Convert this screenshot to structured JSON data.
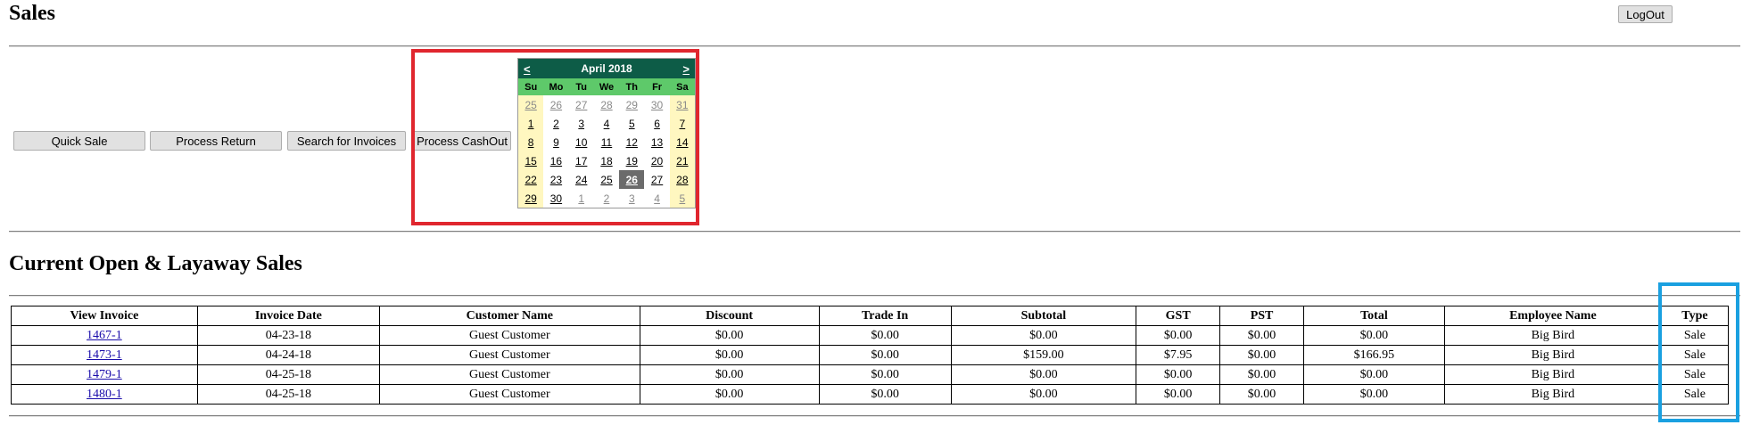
{
  "header": {
    "title": "Sales",
    "logout_label": "LogOut"
  },
  "actions": {
    "quick_sale": "Quick Sale",
    "process_return": "Process Return",
    "search_invoices": "Search for Invoices",
    "process_cashout": "Process CashOut"
  },
  "calendar": {
    "prev": "<",
    "next": ">",
    "month_label": "April 2018",
    "weekdays": [
      "Su",
      "Mo",
      "Tu",
      "We",
      "Th",
      "Fr",
      "Sa"
    ],
    "days": [
      {
        "d": "25",
        "other": true
      },
      {
        "d": "26",
        "other": true
      },
      {
        "d": "27",
        "other": true
      },
      {
        "d": "28",
        "other": true
      },
      {
        "d": "29",
        "other": true
      },
      {
        "d": "30",
        "other": true
      },
      {
        "d": "31",
        "other": true
      },
      {
        "d": "1"
      },
      {
        "d": "2"
      },
      {
        "d": "3"
      },
      {
        "d": "4"
      },
      {
        "d": "5"
      },
      {
        "d": "6"
      },
      {
        "d": "7"
      },
      {
        "d": "8"
      },
      {
        "d": "9"
      },
      {
        "d": "10"
      },
      {
        "d": "11"
      },
      {
        "d": "12"
      },
      {
        "d": "13"
      },
      {
        "d": "14"
      },
      {
        "d": "15"
      },
      {
        "d": "16"
      },
      {
        "d": "17"
      },
      {
        "d": "18"
      },
      {
        "d": "19"
      },
      {
        "d": "20"
      },
      {
        "d": "21"
      },
      {
        "d": "22"
      },
      {
        "d": "23"
      },
      {
        "d": "24"
      },
      {
        "d": "25"
      },
      {
        "d": "26",
        "selected": true
      },
      {
        "d": "27"
      },
      {
        "d": "28"
      },
      {
        "d": "29"
      },
      {
        "d": "30"
      },
      {
        "d": "1",
        "other": true
      },
      {
        "d": "2",
        "other": true
      },
      {
        "d": "3",
        "other": true
      },
      {
        "d": "4",
        "other": true
      },
      {
        "d": "5",
        "other": true
      }
    ]
  },
  "section": {
    "title": "Current Open & Layaway Sales"
  },
  "table": {
    "headers": [
      "View Invoice",
      "Invoice Date",
      "Customer Name",
      "Discount",
      "Trade In",
      "Subtotal",
      "GST",
      "PST",
      "Total",
      "Employee Name",
      "Type"
    ],
    "rows": [
      [
        "1467-1",
        "04-23-18",
        "Guest Customer",
        "$0.00",
        "$0.00",
        "$0.00",
        "$0.00",
        "$0.00",
        "$0.00",
        "Big Bird",
        "Sale"
      ],
      [
        "1473-1",
        "04-24-18",
        "Guest Customer",
        "$0.00",
        "$0.00",
        "$159.00",
        "$7.95",
        "$0.00",
        "$166.95",
        "Big Bird",
        "Sale"
      ],
      [
        "1479-1",
        "04-25-18",
        "Guest Customer",
        "$0.00",
        "$0.00",
        "$0.00",
        "$0.00",
        "$0.00",
        "$0.00",
        "Big Bird",
        "Sale"
      ],
      [
        "1480-1",
        "04-25-18",
        "Guest Customer",
        "$0.00",
        "$0.00",
        "$0.00",
        "$0.00",
        "$0.00",
        "$0.00",
        "Big Bird",
        "Sale"
      ]
    ]
  },
  "colors": {
    "calendar_header": "#0d5c47",
    "calendar_weekday_bar": "#5ec96a",
    "weekend_bg": "#fff7c0",
    "selected_day": "#6b6b6b",
    "highlight_red": "#e0262e",
    "highlight_blue": "#1aa0e0"
  }
}
